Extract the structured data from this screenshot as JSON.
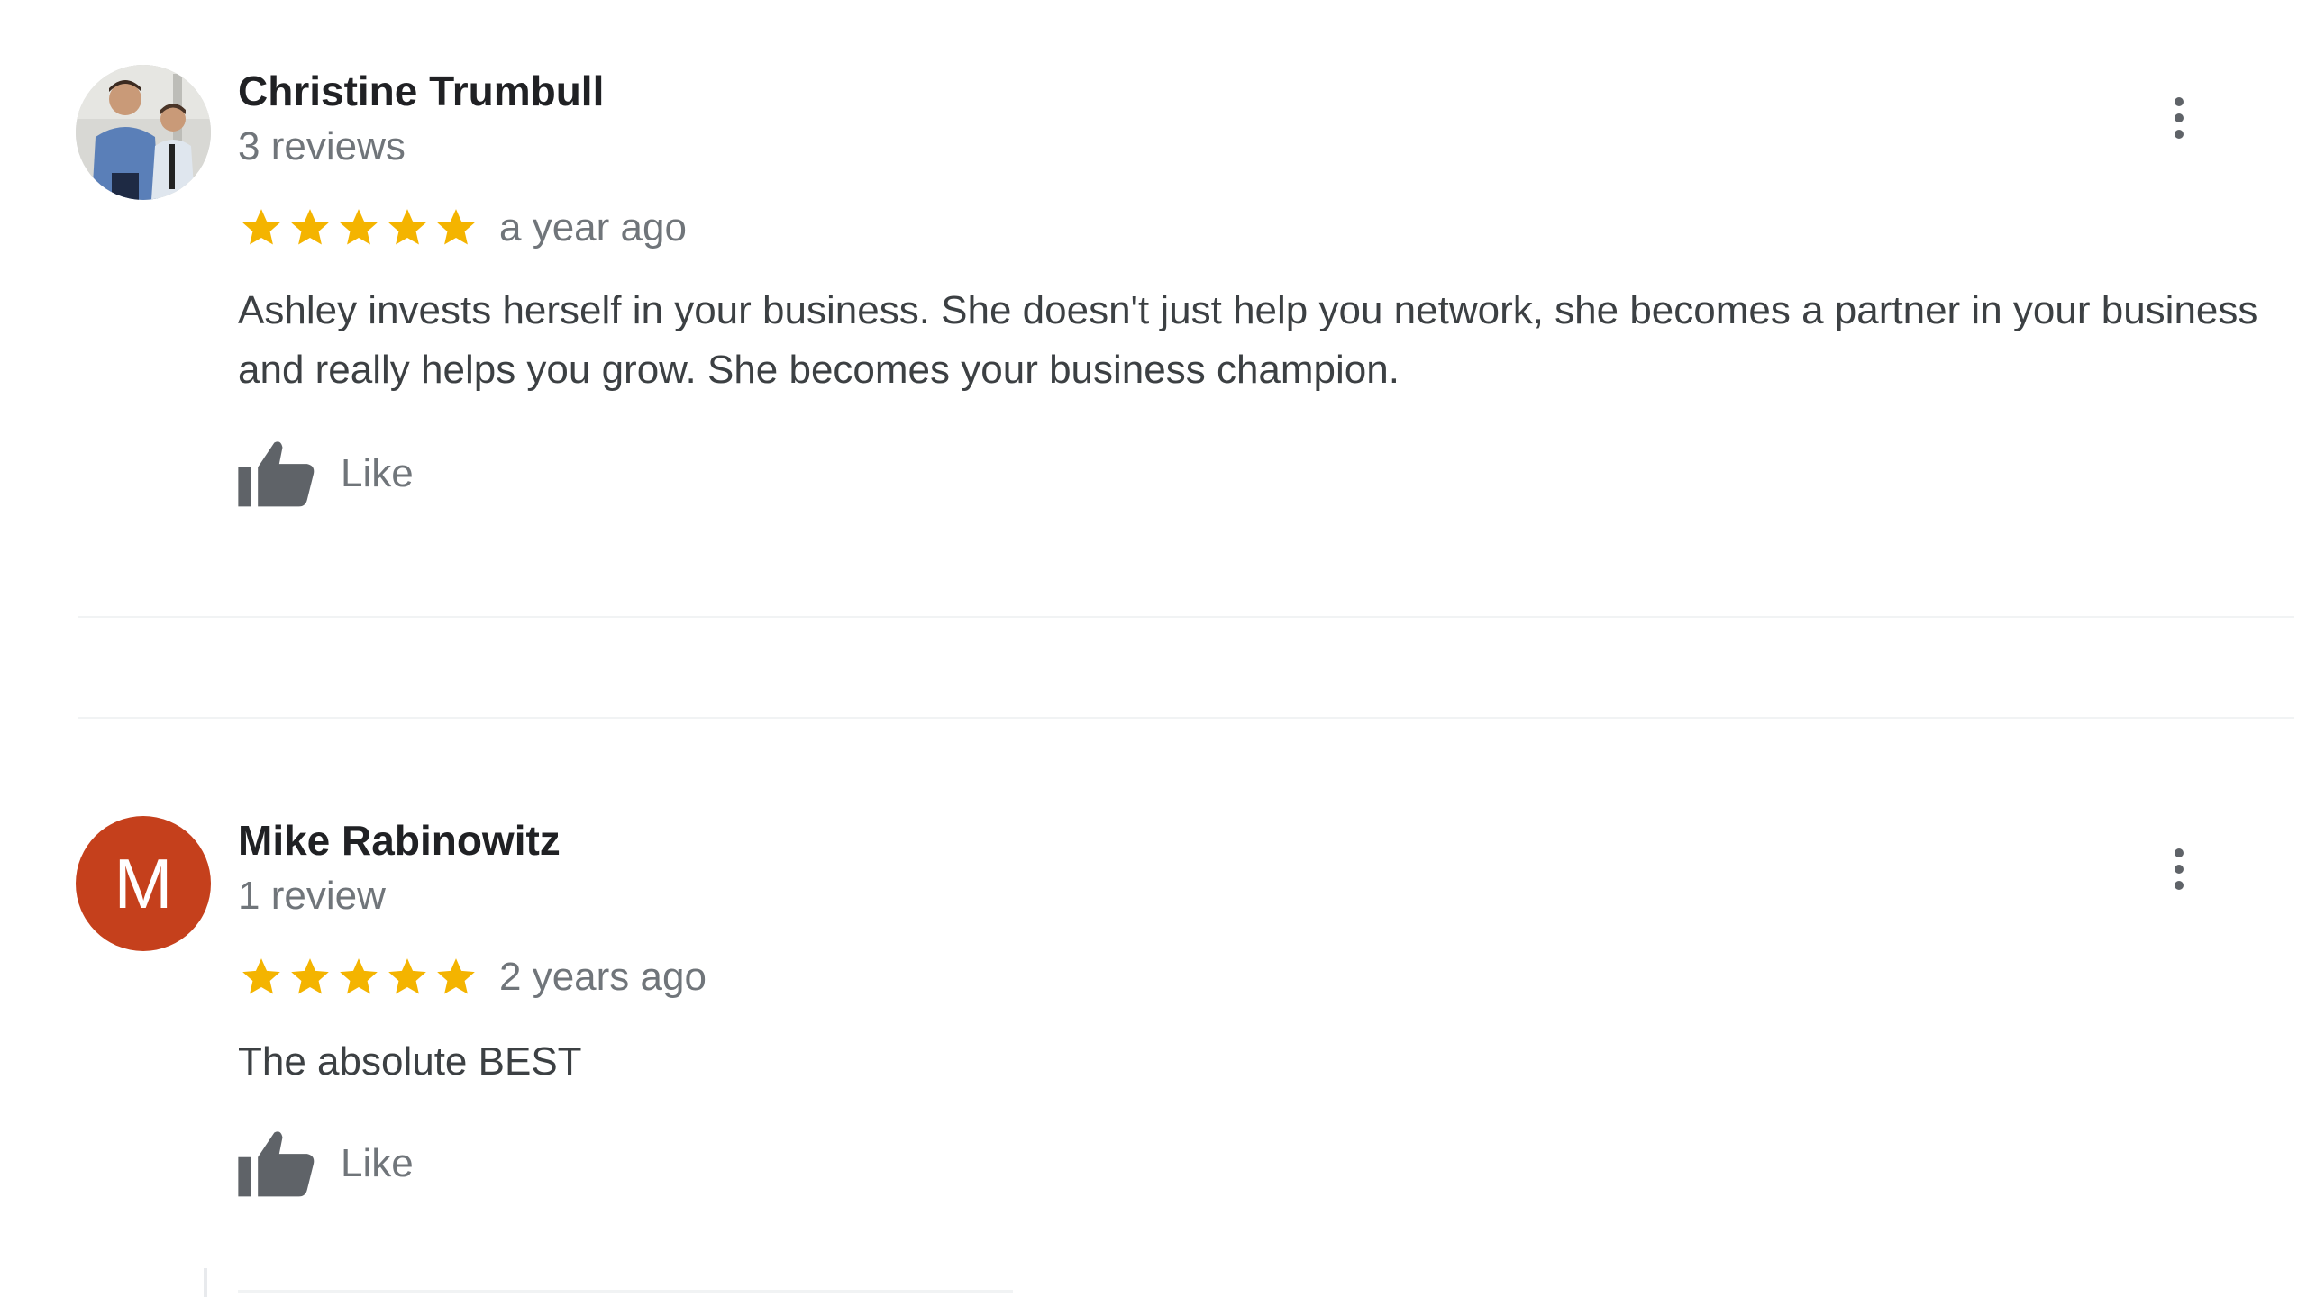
{
  "colors": {
    "star": "#f4b400",
    "avatar_m_bg": "#c5401c",
    "muted_text": "#70757a",
    "body_text": "#3c4043"
  },
  "reviews": [
    {
      "name": "Christine Trumbull",
      "review_count": "3 reviews",
      "rating": 5,
      "time": "a year ago",
      "text": "Ashley invests herself in your business. She doesn't just help you network, she becomes a partner in your business and really helps you grow. She becomes your business champion.",
      "like_label": "Like",
      "avatar_type": "photo"
    },
    {
      "name": "Mike Rabinowitz",
      "review_count": "1 review",
      "rating": 5,
      "time": "2 years ago",
      "text": "The absolute BEST",
      "like_label": "Like",
      "avatar_type": "letter",
      "avatar_letter": "M"
    }
  ],
  "icons": {
    "more": "more-vert-icon",
    "like": "thumbs-up-icon",
    "star": "star-icon"
  }
}
